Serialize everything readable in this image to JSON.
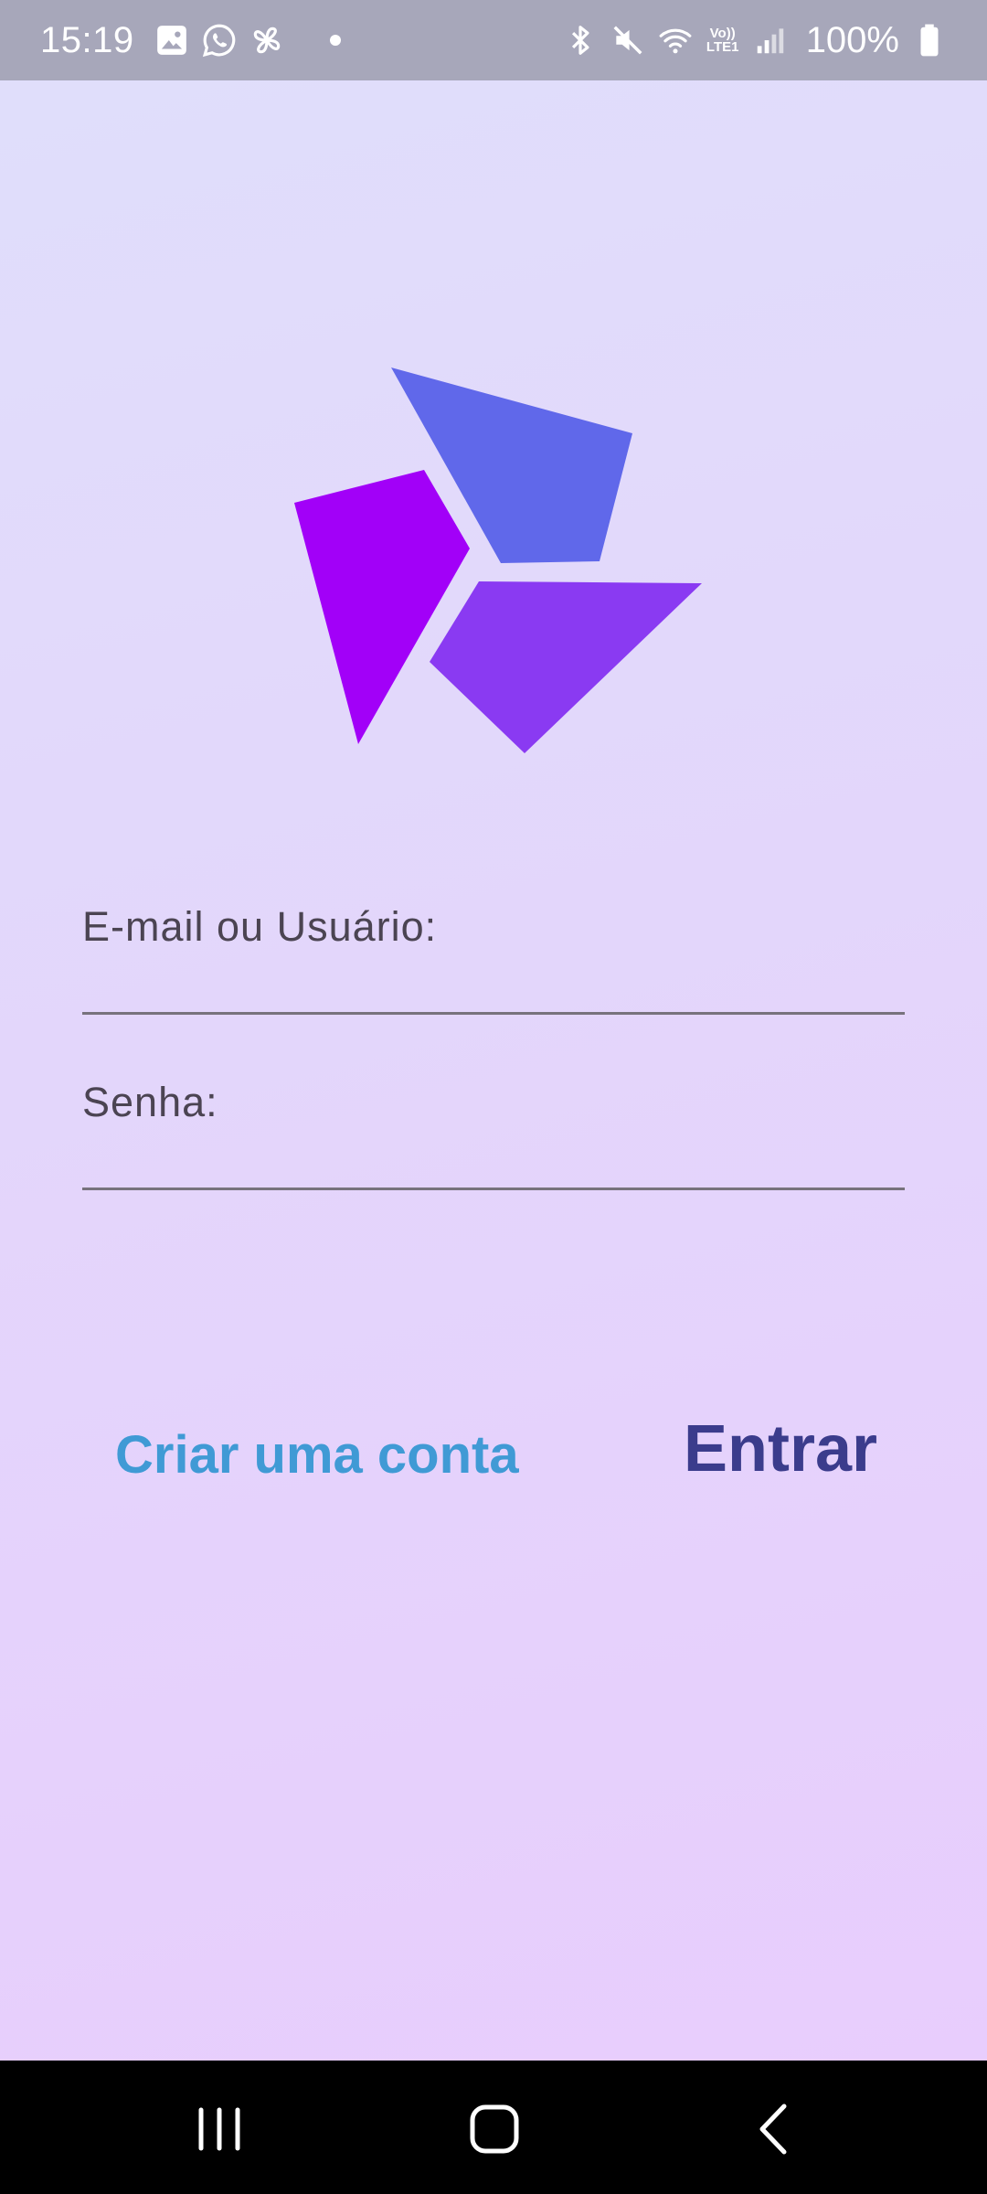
{
  "status_bar": {
    "time": "15:19",
    "battery_percent": "100%",
    "network_label": "Vo)) LTE1",
    "icons": [
      "gallery-icon",
      "whatsapp-icon",
      "pinwheel-app-icon",
      "notification-dot",
      "bluetooth-icon",
      "mute-icon",
      "wifi-icon",
      "lte-icon",
      "signal-icon",
      "battery-icon"
    ]
  },
  "login": {
    "email_label": "E-mail ou Usuário:",
    "email_value": "",
    "password_label": "Senha:",
    "password_value": "",
    "create_account_label": "Criar uma conta",
    "enter_label": "Entrar"
  },
  "colors": {
    "create_account": "#409ad5",
    "enter": "#3b3c8c",
    "logo_blue": "#6068ea",
    "logo_magenta": "#a200f8",
    "logo_violet": "#8a3af2",
    "status_bar_bg": "#a7a7ba"
  },
  "nav_bar": {
    "icons": [
      "recent-apps-icon",
      "home-icon",
      "back-icon"
    ]
  }
}
